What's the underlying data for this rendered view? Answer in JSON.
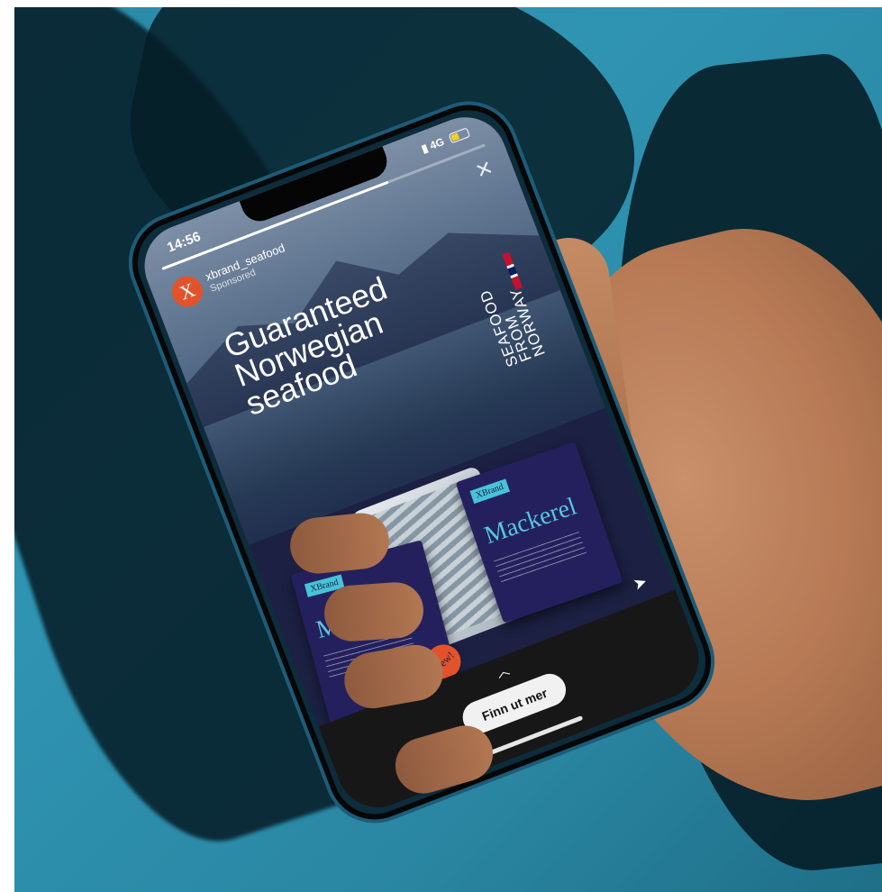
{
  "status_bar": {
    "time": "14:56",
    "network": "4G"
  },
  "story": {
    "progress": 0.7,
    "account_name": "xbrand_seafood",
    "sponsored_label": "Sponsored",
    "avatar_letter": "X",
    "headline": [
      "Guaranteed",
      "Norwegian",
      "seafood"
    ],
    "brand_logo_text": [
      "SEAFOOD",
      "FROM",
      "NORWAY"
    ],
    "products": [
      {
        "brand": "XBrand",
        "title": "Mackerel",
        "badge": "New!"
      },
      {
        "brand": "XBrand",
        "title": "Mackerel"
      }
    ],
    "cta_label": "Finn ut mer"
  },
  "colors": {
    "avatar": "#e2532c",
    "pack": "#24205e",
    "pack_accent": "#56c7de",
    "background": "#2f94b2"
  }
}
